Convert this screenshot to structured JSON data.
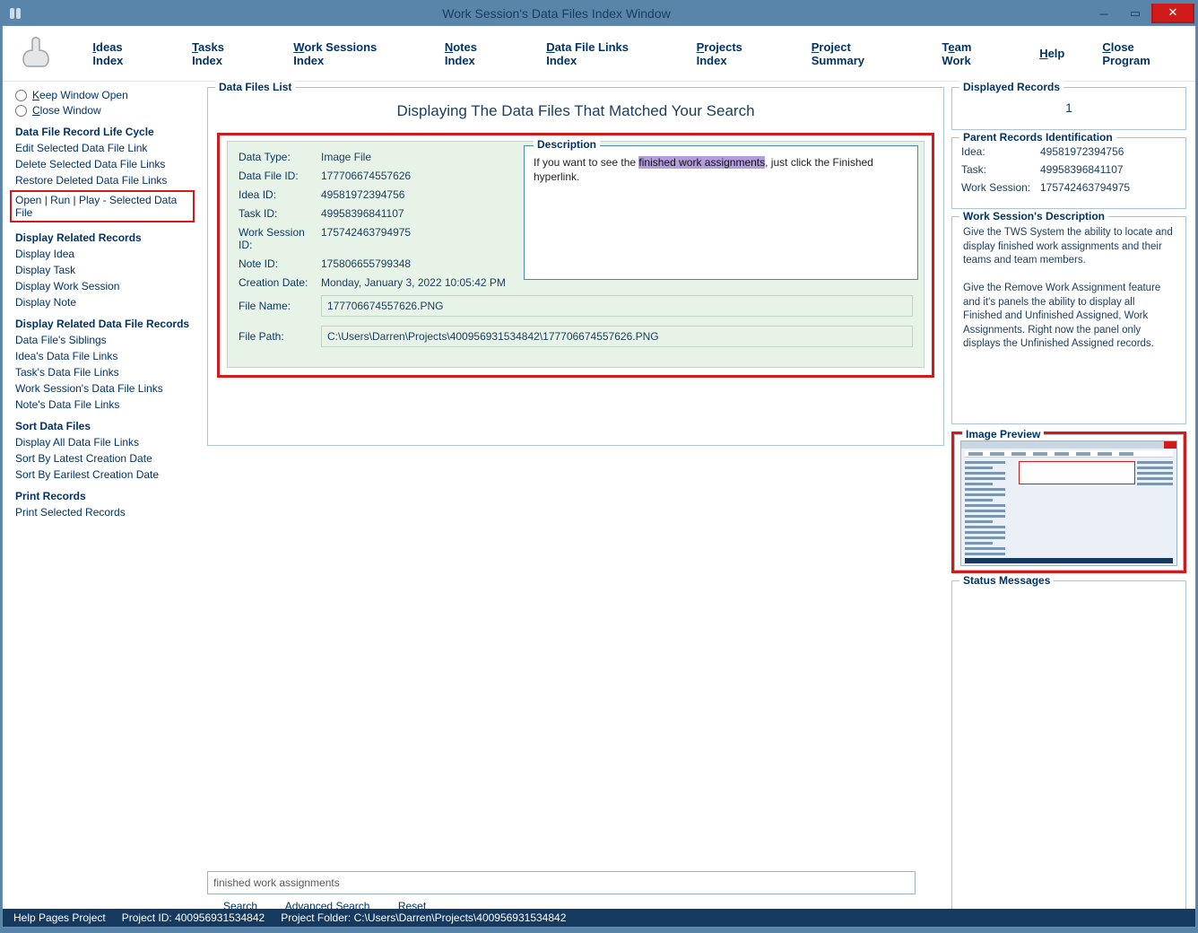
{
  "window": {
    "title": "Work Session's Data Files Index Window",
    "icon_name": "app-logo-icon"
  },
  "menubar": {
    "ideas": "Ideas Index",
    "tasks": "Tasks Index",
    "work_sessions": "Work Sessions Index",
    "notes": "Notes Index",
    "dfl": "Data File Links Index",
    "projects": "Projects Index",
    "summary": "Project Summary",
    "team": "Team Work",
    "help": "Help",
    "close": "Close Program"
  },
  "sidebar": {
    "keep_open": "Keep Window Open",
    "close_window": "Close Window",
    "life_cycle_h": "Data File Record Life Cycle",
    "edit_link": "Edit Selected Data File Link",
    "delete_link": "Delete Selected Data File Links",
    "restore_link": "Restore Deleted Data File Links",
    "open_run": "Open | Run | Play - Selected Data File",
    "related_h": "Display Related Records",
    "disp_idea": "Display Idea",
    "disp_task": "Display Task",
    "disp_ws": "Display Work Session",
    "disp_note": "Display Note",
    "related_df_h": "Display Related Data File Records",
    "siblings": "Data File's Siblings",
    "idea_dfl": "Idea's Data File Links",
    "task_dfl": "Task's Data File Links",
    "ws_dfl": "Work Session's Data File Links",
    "note_dfl": "Note's Data File Links",
    "sort_h": "Sort Data Files",
    "disp_all": "Display All Data File Links",
    "sort_latest": "Sort By Latest Creation Date",
    "sort_earliest": "Sort By Earilest Creation Date",
    "print_h": "Print Records",
    "print_sel": "Print Selected Records"
  },
  "dfl": {
    "legend": "Data Files List",
    "title": "Displaying The Data Files That Matched Your Search",
    "labels": {
      "data_type": "Data Type:",
      "data_file_id": "Data File ID:",
      "idea_id": "Idea ID:",
      "task_id": "Task ID:",
      "ws_id": "Work Session ID:",
      "note_id": "Note ID:",
      "creation": "Creation Date:",
      "file_name": "File Name:",
      "file_path": "File Path:"
    },
    "values": {
      "data_type": "Image File",
      "data_file_id": "177706674557626",
      "idea_id": "49581972394756",
      "task_id": "49958396841107",
      "ws_id": "175742463794975",
      "note_id": "175806655799348",
      "creation": "Monday, January 3, 2022   10:05:42 PM",
      "file_name": "177706674557626.PNG",
      "file_path": "C:\\Users\\Darren\\Projects\\400956931534842\\177706674557626.PNG"
    },
    "desc_legend": "Description",
    "desc_pre": "If you want to see the ",
    "desc_hl": "finished work assignments",
    "desc_post": ", just click the Finished hyperlink."
  },
  "search": {
    "value": "finished work assignments",
    "search": "Search",
    "advanced": "Advanced Search",
    "reset": "Reset"
  },
  "right": {
    "disp_legend": "Displayed Records",
    "disp_val": "1",
    "parent_legend": "Parent Records Identification",
    "idea_l": "Idea:",
    "idea_v": "49581972394756",
    "task_l": "Task:",
    "task_v": "49958396841107",
    "ws_l": "Work Session:",
    "ws_v": "175742463794975",
    "wsdesc_legend": "Work Session's Description",
    "wsdesc_p1": "Give the TWS System the ability to locate and display finished work assignments and their teams and team members.",
    "wsdesc_p2": "Give the Remove Work Assignment feature and it's panels the ability to display all Finished and Unfinished Assigned,  Work Assignments. Right now the panel only displays the Unfinished Assigned records.",
    "img_legend": "Image Preview",
    "status_legend": "Status Messages"
  },
  "footer": {
    "help": "Help Pages Project",
    "pid": "Project ID: 400956931534842",
    "pfolder": "Project Folder: C:\\Users\\Darren\\Projects\\400956931534842"
  }
}
